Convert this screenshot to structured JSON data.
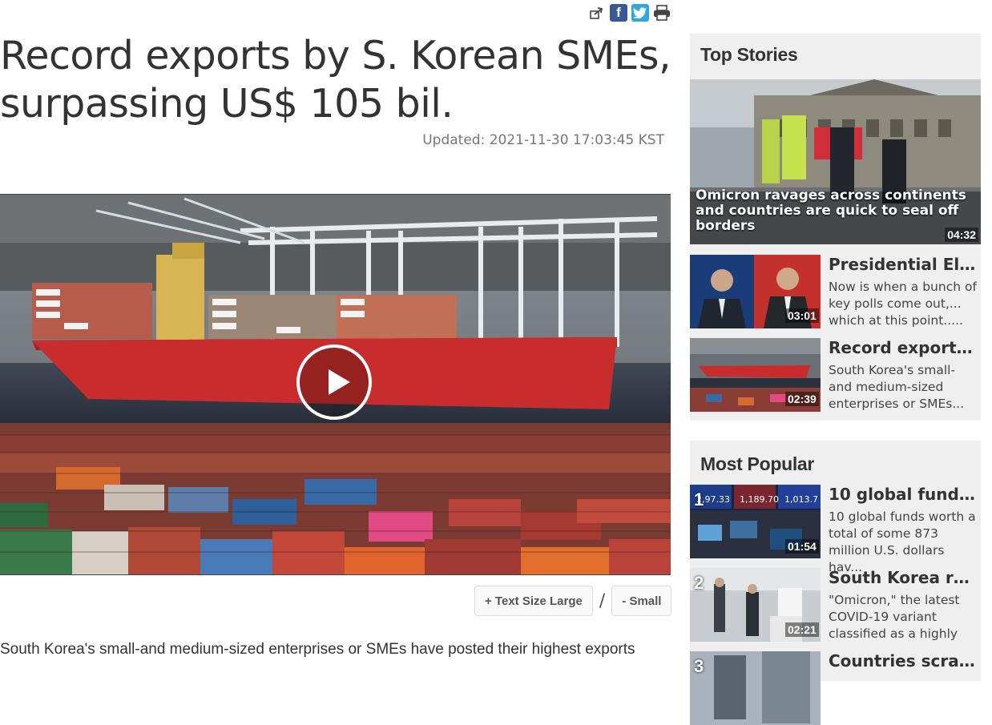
{
  "share": {
    "icons": [
      "share-icon",
      "facebook-icon",
      "twitter-icon",
      "print-icon"
    ]
  },
  "article": {
    "title": "Record exports by S. Korean SMEs, surpassing US$ 105 bil.",
    "updated": "Updated: 2021-11-30 17:03:45 KST",
    "text_size_large": "+ Text Size Large",
    "separator": "/",
    "text_size_small": "- Small",
    "body": "South Korea's small-and medium-sized enterprises or SMEs have posted their highest exports"
  },
  "top_stories": {
    "heading": "Top Stories",
    "hero": {
      "caption": "Omicron ravages across continents and countries are quick to seal off borders",
      "duration": "04:32"
    },
    "items": [
      {
        "title": "Presidential Elec...",
        "desc": "Now is when a bunch of key polls come out,... which at this point.....",
        "duration": "03:01"
      },
      {
        "title": "Record exports b...",
        "desc": "South Korea's small-and medium-sized enterprises or SMEs...",
        "duration": "02:39"
      }
    ]
  },
  "most_popular": {
    "heading": "Most Popular",
    "items": [
      {
        "rank": "1",
        "title": "10 global funds s...",
        "desc": "10 global funds worth a total of some 873 million U.S. dollars hav...",
        "duration": "01:54"
      },
      {
        "rank": "2",
        "title": "South Korea rest...",
        "desc": "\"Omicron,\" the latest COVID-19 variant classified as a highly",
        "duration": "02:21"
      },
      {
        "rank": "3",
        "title": "Countries scram...",
        "desc": "",
        "duration": ""
      }
    ]
  }
}
